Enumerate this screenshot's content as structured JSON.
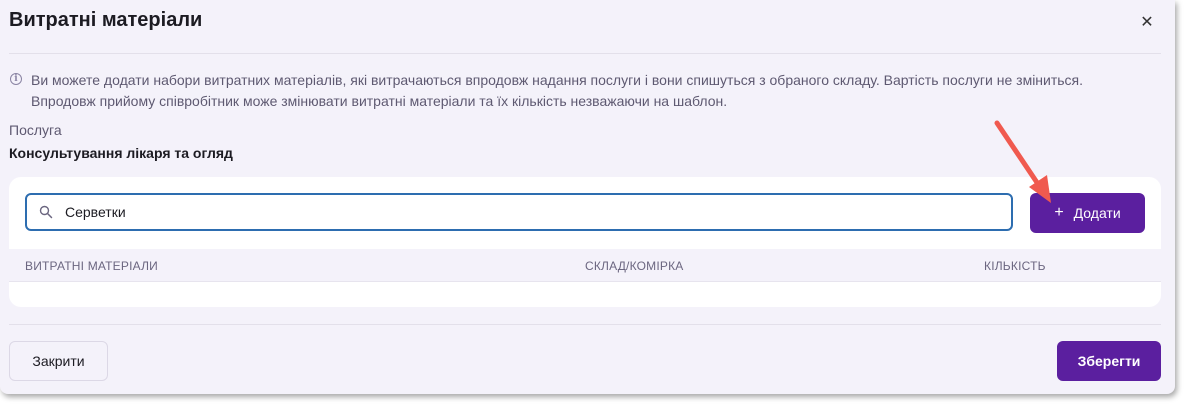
{
  "dialog": {
    "title": "Витратні матеріали",
    "close_icon": "close-icon"
  },
  "info": {
    "icon": "info-icon",
    "line1": "Ви можете додати набори витратних матеріалів, які витрачаються впродовж надання послуги і вони спишуться з обраного складу. Вартість послуги не зміниться.",
    "line2": "Впродовж прийому співробітник може змінювати витратні матеріали та їх кількість незважаючи на шаблон."
  },
  "service": {
    "label": "Послуга",
    "value": "Консультування лікаря та огляд"
  },
  "search": {
    "value": "Серветки",
    "icon": "search-icon"
  },
  "add_button": {
    "icon": "plus-icon",
    "label": "Додати"
  },
  "table": {
    "columns": [
      "ВИТРАТНІ МАТЕРІАЛИ",
      "СКЛАД/КОМІРКА",
      "КІЛЬКІСТЬ"
    ],
    "rows": []
  },
  "footer": {
    "close_label": "Закрити",
    "save_label": "Зберегти"
  },
  "colors": {
    "accent": "#5b1f9f",
    "search_border": "#2d6db0",
    "annotation_arrow": "#f05a4f"
  }
}
